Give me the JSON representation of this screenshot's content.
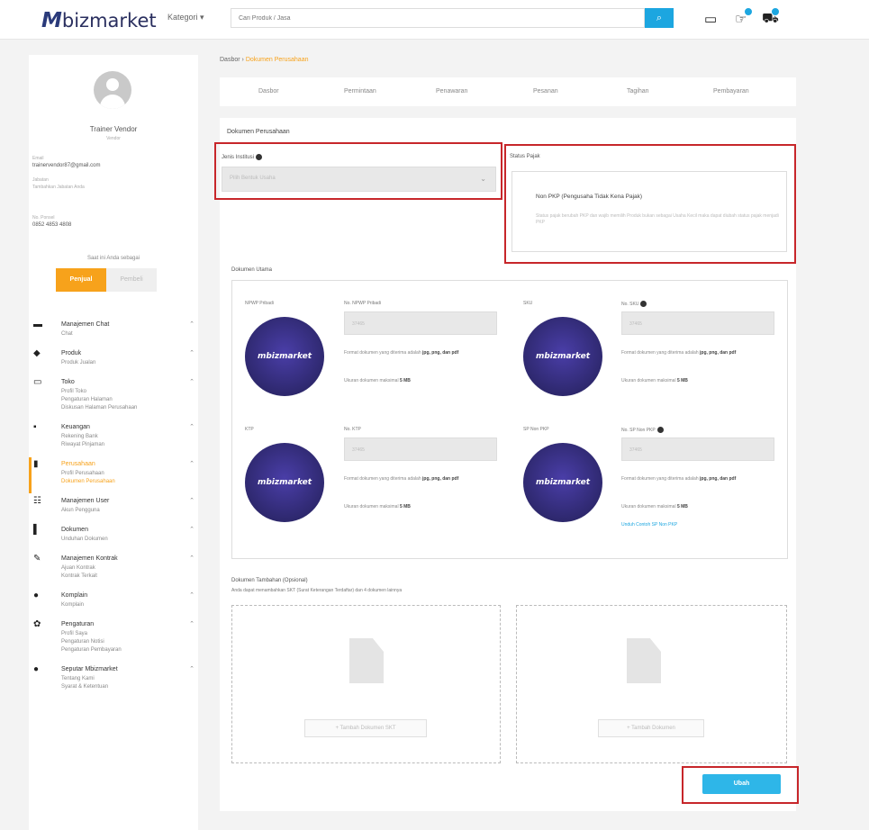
{
  "header": {
    "logo_prefix": "M",
    "logo_text": "bizmarket",
    "kategori": "Kategori ▾",
    "search_placeholder": "Cari Produk / Jasa",
    "search_icon": "search-icon",
    "icons": [
      "store-icon",
      "thumbs-up-icon",
      "cart-icon"
    ]
  },
  "sidebar": {
    "user_name": "Trainer Vendor",
    "user_role": "Vendor",
    "email_label": "Email",
    "email": "trainervendor87@gmail.com",
    "jabatan_label": "Jabatan",
    "jabatan": "Tambahkan Jabatan Anda",
    "phone_label": "No. Ponsel",
    "phone": "0852 4853 4808",
    "as_label": "Saat ini Anda sebagai",
    "role_buyer": "Penjual",
    "role_seller": "Pembeli",
    "menu": [
      {
        "icon": "chat-icon",
        "title": "Manajemen Chat",
        "items": [
          "Chat"
        ]
      },
      {
        "icon": "product-icon",
        "title": "Produk",
        "items": [
          "Produk Jualan"
        ]
      },
      {
        "icon": "store-icon",
        "title": "Toko",
        "items": [
          "Profil Toko",
          "Pengaturan Halaman",
          "Diskusan Halaman Perusahaan"
        ]
      },
      {
        "icon": "wallet-icon",
        "title": "Keuangan",
        "items": [
          "Rekening Bank",
          "Riwayat Pinjaman"
        ]
      },
      {
        "icon": "building-icon",
        "title": "Perusahaan",
        "items": [
          "Profil Perusahaan",
          "Dokumen Perusahaan"
        ],
        "active": true
      },
      {
        "icon": "users-icon",
        "title": "Manajemen User",
        "items": [
          "Akun Pengguna"
        ]
      },
      {
        "icon": "document-icon",
        "title": "Dokumen",
        "items": [
          "Unduhan Dokumen"
        ]
      },
      {
        "icon": "contract-icon",
        "title": "Manajemen Kontrak",
        "items": [
          "Ajuan Kontrak",
          "Kontrak Terkait"
        ]
      },
      {
        "icon": "info-icon",
        "title": "Komplain",
        "items": [
          "Komplain"
        ]
      },
      {
        "icon": "gear-icon",
        "title": "Pengaturan",
        "items": [
          "Profil Saya",
          "Pengaturan Notisi",
          "Pengaturan Pembayaran"
        ]
      },
      {
        "icon": "info-icon",
        "title": "Seputar Mbizmarket",
        "items": [
          "Tentang Kami",
          "Syarat & Ketentuan"
        ]
      }
    ]
  },
  "breadcrumb": {
    "root": "Dasbor",
    "sep": "›",
    "current": "Dokumen Perusahaan"
  },
  "tabs": [
    "Dasbor",
    "Permintaan",
    "Penawaran",
    "Pesanan",
    "Tagihan",
    "Pembayaran"
  ],
  "main": {
    "title": "Dokumen Perusahaan",
    "jenis_label": "Jenis Institusi",
    "jenis_placeholder": "Pilih Bentuk Usaha",
    "pajak_label": "Status Pajak",
    "pajak_value": "Non PKP (Pengusaha Tidak Kena Pajak)",
    "pajak_desc": "Status pajak berubah PKP dan wajib memilih Produk bukan sebagai Usaha Kecil maka dapat diubah status pajak menjadi PKP",
    "dokumen_utama": "Dokumen Utama",
    "docs": [
      {
        "label": "NPWP Pribadi",
        "no_label": "No. NPWP Pribadi",
        "value": "37465"
      },
      {
        "label": "SKU",
        "no_label": "No. SKU",
        "value": "37465"
      },
      {
        "label": "KTP",
        "no_label": "No. KTP",
        "value": "37465"
      },
      {
        "label": "SP Non PKP",
        "no_label": "No. SP Non PKP",
        "value": "37465",
        "link": "Unduh Contoh SP Non PKP"
      }
    ],
    "format_text": "Format dokumen yang diterima adalah ",
    "formats": "jpg, png, dan pdf",
    "size_text": "Ukuran dokumen maksimal ",
    "size": "5 MB",
    "circle_text": "mbizmarket",
    "tambahan_title": "Dokumen Tambahan (Opsional)",
    "tambahan_desc": "Anda dapat menambahkan SKT (Surat Keterangan Terdaftar) dan 4 dokumen lainnya",
    "upload_skt": "+ Tambah Dokumen SKT",
    "upload_other": "+ Tambah Dokumen",
    "save": "Ubah"
  }
}
